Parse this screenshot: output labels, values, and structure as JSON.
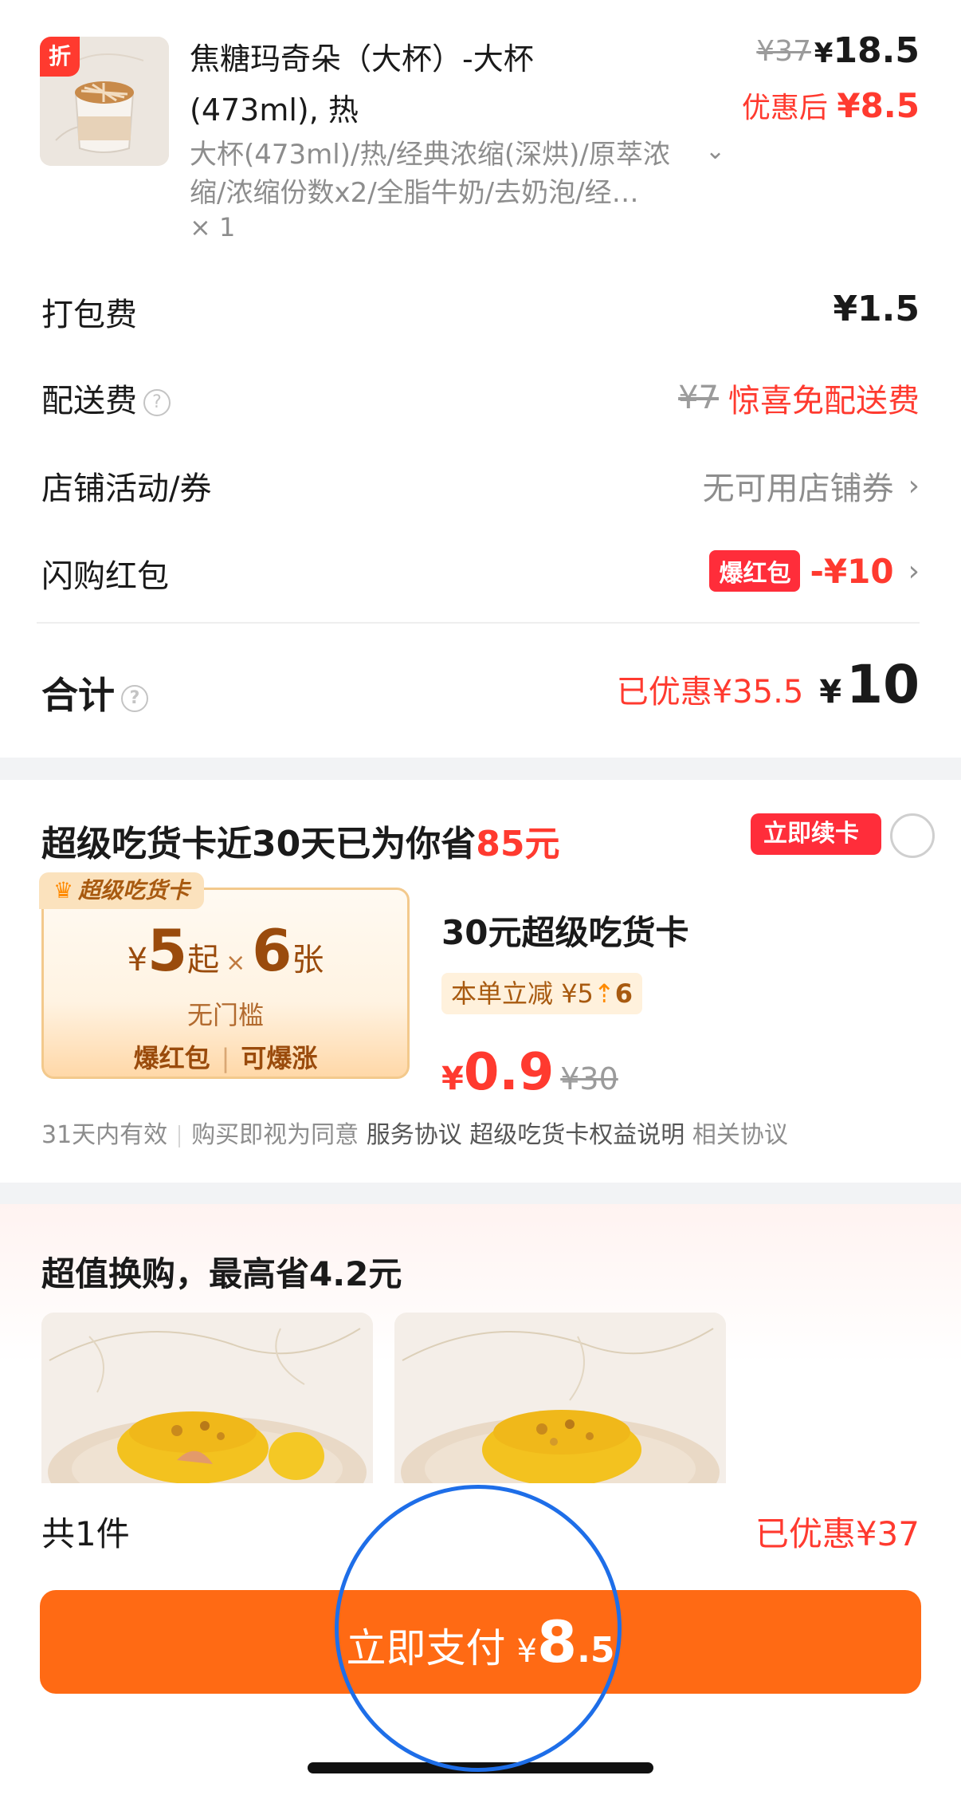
{
  "product": {
    "discount_tag": "折",
    "name_line1": "焦糖玛奇朵（大杯）-大杯",
    "name_line2": "(473ml), 热",
    "spec_line1": "大杯(473ml)/热/经典浓缩(深烘)/原萃浓",
    "spec_line2": "缩/浓缩份数x2/全脂牛奶/去奶泡/经…",
    "quantity": "× 1",
    "original_price": "¥37",
    "price_currency": "¥",
    "price": "18.5",
    "after_label": "优惠后",
    "after_price": "¥8.5"
  },
  "fees": {
    "packaging_label": "打包费",
    "packaging_value": "¥1.5",
    "delivery_label": "配送费",
    "delivery_original": "¥7",
    "delivery_value": "惊喜免配送费",
    "store_coupon_label": "店铺活动/券",
    "store_coupon_value": "无可用店铺券",
    "redpacket_label": "闪购红包",
    "redpacket_tag": "爆红包",
    "redpacket_value": "-¥10"
  },
  "total": {
    "label": "合计",
    "saved": "已优惠¥35.5",
    "currency": "¥",
    "amount": "10"
  },
  "vip": {
    "title_prefix": "超级吃货卡近30天已为你省",
    "title_amount": "85元",
    "renew_button": "立即续卡",
    "badge": "超级吃货卡",
    "coupon_yen": "¥",
    "coupon_amount": "5",
    "coupon_from": "起",
    "coupon_x": "×",
    "coupon_count": "6",
    "coupon_unit": "张",
    "coupon_threshold": "无门槛",
    "coupon_feature1": "爆红包",
    "coupon_feature2": "可爆涨",
    "card_name": "30元超级吃货卡",
    "card_tag_prefix": "本单立减",
    "card_tag_from": "¥5",
    "card_tag_to": "6",
    "card_price_yen": "¥",
    "card_price": "0.9",
    "card_original": "¥30",
    "validity": "31天内有效",
    "agree_text": "购买即视为同意",
    "link1": "服务协议",
    "link2": "超级吃货卡权益说明",
    "link3": "相关协议"
  },
  "exchange": {
    "title": "超值换购，最高省4.2元"
  },
  "bottom": {
    "count": "共1件",
    "saved": "已优惠¥37",
    "pay_label": "立即支付",
    "pay_yen": "¥",
    "pay_int": "8",
    "pay_dec": ".5"
  },
  "colors": {
    "accent_red": "#ff3a2f",
    "pay_orange": "#ff6a14",
    "vip_gold": "#f3c98c",
    "tap_ring": "#1e6ee8"
  }
}
